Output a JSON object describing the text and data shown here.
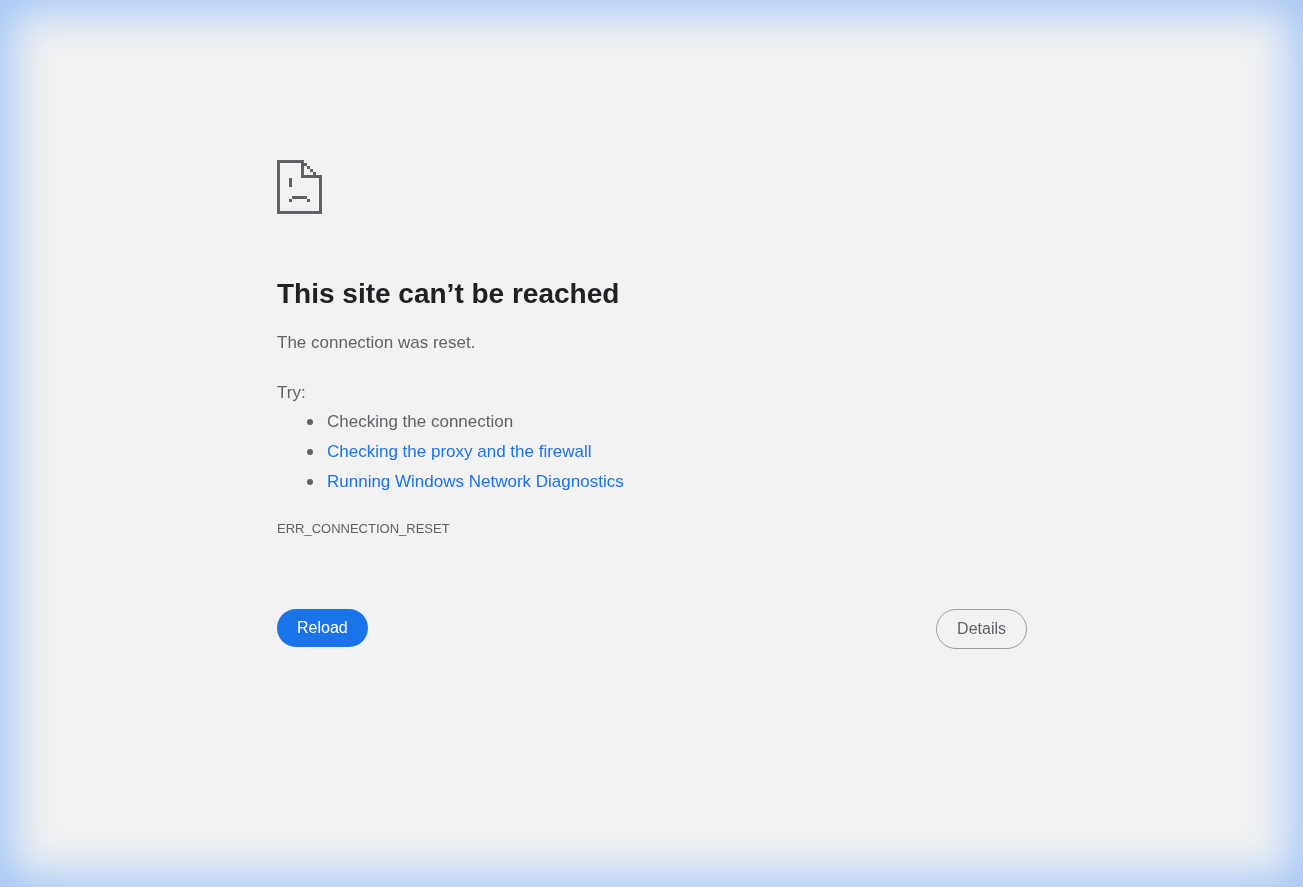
{
  "heading": "This site can’t be reached",
  "message": "The connection was reset.",
  "try_label": "Try:",
  "suggestions": [
    {
      "kind": "text",
      "text": "Checking the connection"
    },
    {
      "kind": "link",
      "text": "Checking the proxy and the firewall"
    },
    {
      "kind": "link",
      "text": "Running Windows Network Diagnostics"
    }
  ],
  "error_code": "ERR_CONNECTION_RESET",
  "buttons": {
    "reload": "Reload",
    "details": "Details"
  }
}
